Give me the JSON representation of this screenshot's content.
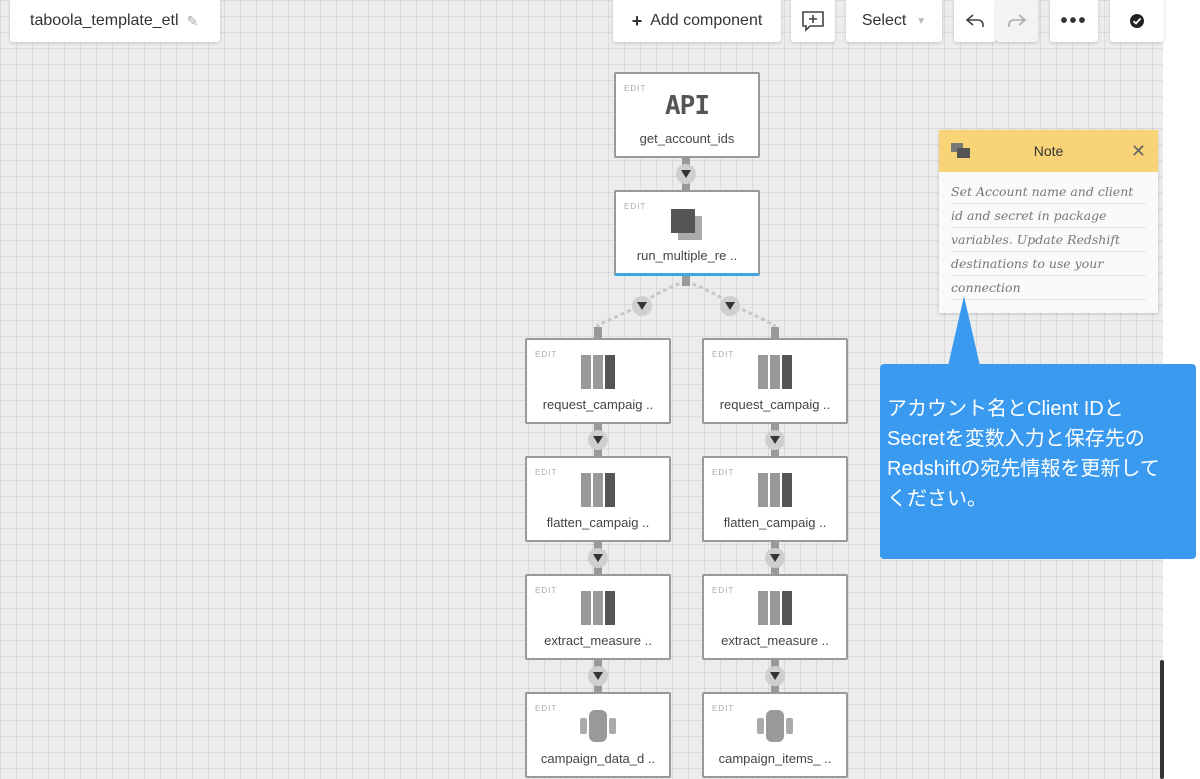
{
  "toolbar": {
    "job_name": "taboola_template_etl",
    "add_component_label": "Add component",
    "select_label": "Select"
  },
  "nodes": {
    "api": {
      "edit": "EDIT",
      "icon_text": "API",
      "label": "get_account_ids"
    },
    "run": {
      "edit": "EDIT",
      "label": "run_multiple_re .."
    },
    "left": [
      {
        "edit": "EDIT",
        "label": "request_campaig .."
      },
      {
        "edit": "EDIT",
        "label": "flatten_campaig .."
      },
      {
        "edit": "EDIT",
        "label": "extract_measure .."
      },
      {
        "edit": "EDIT",
        "label": "campaign_data_d .."
      }
    ],
    "right": [
      {
        "edit": "EDIT",
        "label": "request_campaig .."
      },
      {
        "edit": "EDIT",
        "label": "flatten_campaig .."
      },
      {
        "edit": "EDIT",
        "label": "extract_measure .."
      },
      {
        "edit": "EDIT",
        "label": "campaign_items_ .."
      }
    ]
  },
  "note": {
    "title": "Note",
    "lines": [
      "Set Account name and client",
      "id and secret in package",
      "variables. Update Redshift",
      "destinations to use your",
      "connection"
    ]
  },
  "callout": {
    "lines": [
      "アカウント名とClient IDと",
      "Secretを変数入力と保存先の",
      "Redshiftの宛先情報を更新して",
      "ください。"
    ]
  },
  "colors": {
    "note_header": "#f9d477",
    "callout": "#3a9af0",
    "selected_border": "#3da7de"
  }
}
